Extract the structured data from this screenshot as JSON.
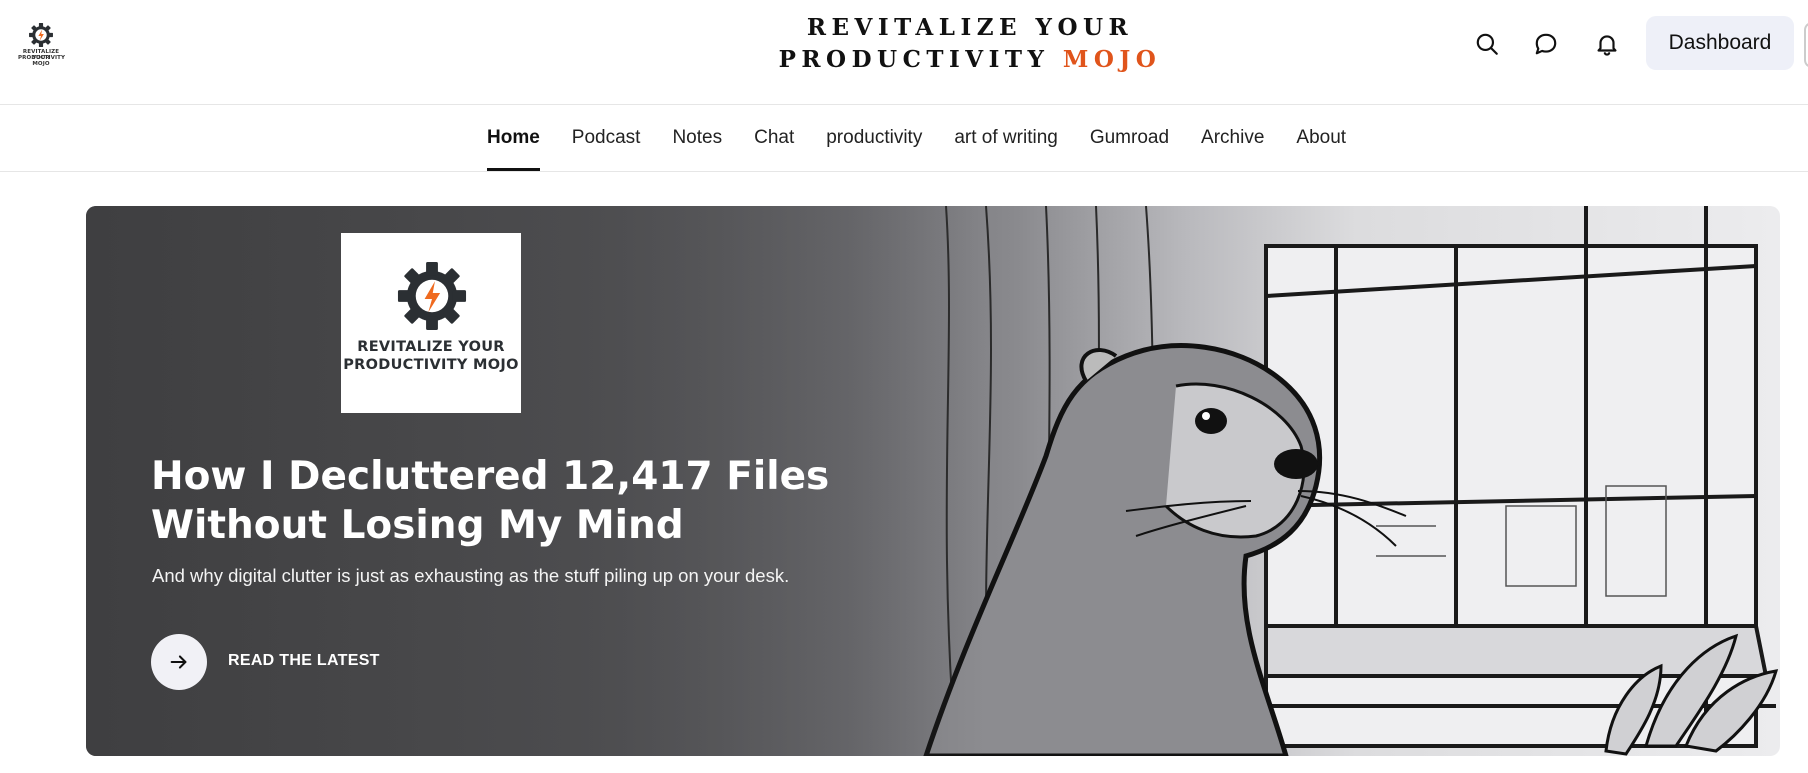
{
  "header": {
    "small_logo_line1": "REVITALIZE YOUR",
    "small_logo_line2": "PRODUCTIVITY MOJO",
    "title_line1": "REVITALIZE YOUR",
    "title_line2_main": "PRODUCTIVITY",
    "title_line2_accent": "MOJO",
    "accent_color": "#e0541b",
    "dashboard_label": "Dashboard",
    "icons": [
      "search-icon",
      "chat-bubble-icon",
      "bell-icon"
    ]
  },
  "nav": {
    "items": [
      {
        "label": "Home",
        "active": true
      },
      {
        "label": "Podcast"
      },
      {
        "label": "Notes"
      },
      {
        "label": "Chat"
      },
      {
        "label": "productivity"
      },
      {
        "label": "art of writing"
      },
      {
        "label": "Gumroad"
      },
      {
        "label": "Archive"
      },
      {
        "label": "About"
      }
    ]
  },
  "hero": {
    "logo_line1": "REVITALIZE YOUR",
    "logo_line2": "PRODUCTIVITY MOJO",
    "title": "How I Decluttered 12,417 Files Without Losing My Mind",
    "subtitle": "And why digital clutter is just as exhausting as the stuff piling up on your desk.",
    "cta_label": "READ THE LATEST",
    "image_subject": "otter-sketch-illustration"
  }
}
